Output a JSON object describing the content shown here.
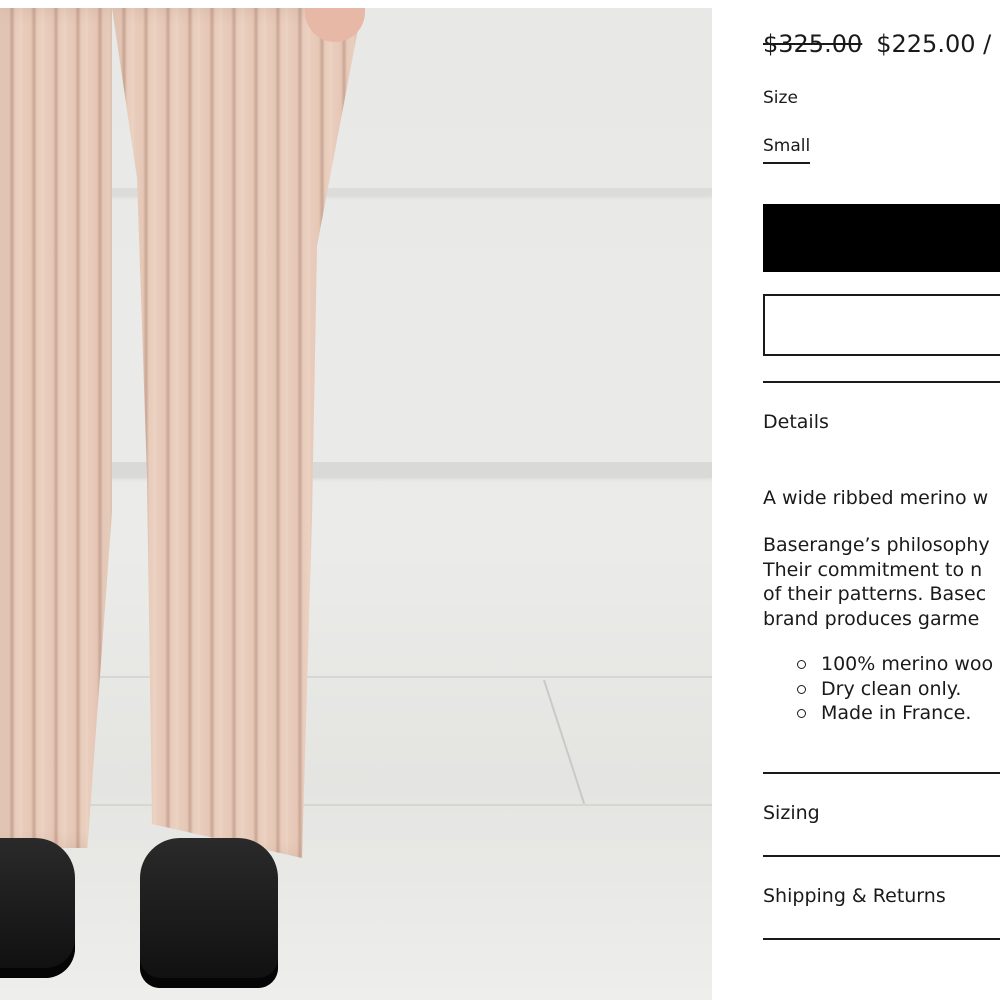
{
  "product": {
    "price_original": "$325.00",
    "price_sale": "$225.00",
    "price_trailing": "/"
  },
  "size": {
    "label": "Size",
    "selected": "Small"
  },
  "buttons": {
    "primary_label": "",
    "secondary_label": ""
  },
  "accordion": {
    "details_title": "Details",
    "details_paragraph_1": "A wide ribbed merino w",
    "details_paragraph_2_lines": [
      "Baserange’s philosophy",
      "Their commitment to n",
      "of their patterns. Basec",
      "brand produces garme"
    ],
    "details_bullets": [
      "100% merino woo",
      "Dry clean only.",
      "Made in France."
    ],
    "sizing_title": "Sizing",
    "shipping_title": "Shipping & Returns"
  },
  "colors": {
    "button_primary": "#000000",
    "text": "#1a1a1a",
    "background": "#ffffff"
  }
}
